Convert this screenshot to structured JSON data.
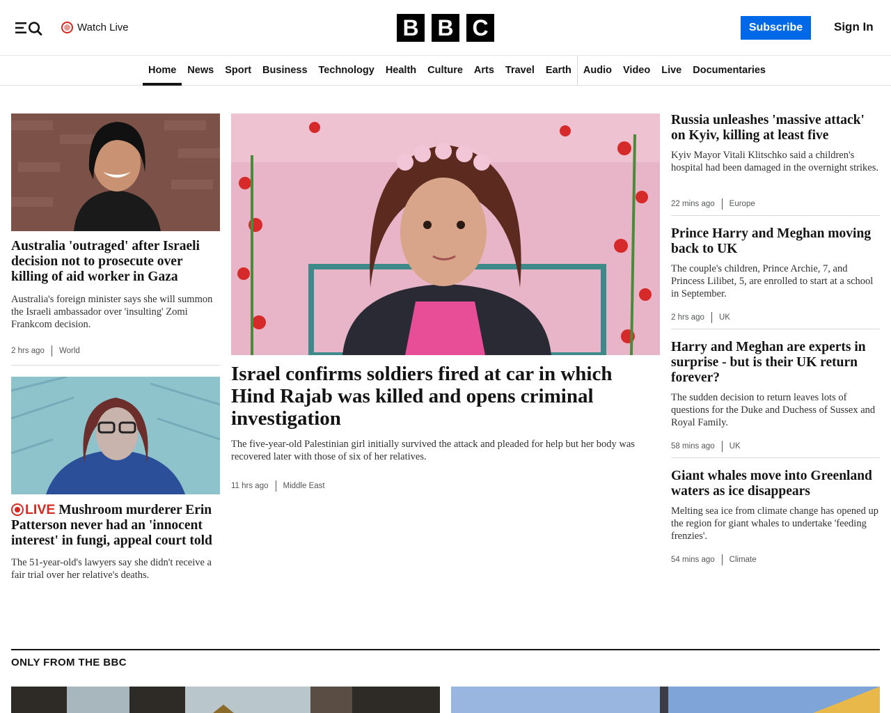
{
  "header": {
    "watch_live": "Watch Live",
    "logo_letters": [
      "B",
      "B",
      "C"
    ],
    "subscribe": "Subscribe",
    "sign_in": "Sign In"
  },
  "nav": {
    "items": [
      "Home",
      "News",
      "Sport",
      "Business",
      "Technology",
      "Health",
      "Culture",
      "Arts",
      "Travel",
      "Earth",
      "Audio",
      "Video",
      "Live",
      "Documentaries"
    ],
    "active": "Home"
  },
  "stories": {
    "left1": {
      "headline": "Australia 'outraged' after Israeli decision not to prosecute over killing of aid worker in Gaza",
      "summary": "Australia's foreign minister says she will summon the Israeli ambassador over 'insulting' Zomi Frankcom decision.",
      "time": "2 hrs ago",
      "section": "World"
    },
    "left2": {
      "live": "LIVE",
      "headline": "Mushroom murderer Erin Patterson never had an 'innocent interest' in fungi, appeal court told",
      "summary": "The 51-year-old's lawyers say she didn't receive a fair trial over her relative's deaths."
    },
    "main": {
      "headline": "Israel confirms soldiers fired at car in which Hind Rajab was killed and opens criminal investigation",
      "summary": "The five-year-old Palestinian girl initially survived the attack and pleaded for help but her body was recovered later with those of six of her relatives.",
      "time": "11 hrs ago",
      "section": "Middle East"
    },
    "right": [
      {
        "headline": "Russia unleashes 'massive attack' on Kyiv, killing at least five",
        "summary": "Kyiv Mayor Vitali Klitschko said a children's hospital had been damaged in the overnight strikes.",
        "time": "22 mins ago",
        "section": "Europe"
      },
      {
        "headline": "Prince Harry and Meghan moving back to UK",
        "summary": "The couple's children, Prince Archie, 7, and Princess Lilibet, 5, are enrolled to start at a school in September.",
        "time": "2 hrs ago",
        "section": "UK"
      },
      {
        "headline": "Harry and Meghan are experts in surprise - but is their UK return forever?",
        "summary": "The sudden decision to return leaves lots of questions for the Duke and Duchess of Sussex and Royal Family.",
        "time": "58 mins ago",
        "section": "UK"
      },
      {
        "headline": "Giant whales move into Greenland waters as ice disappears",
        "summary": "Melting sea ice from climate change has opened up the region for giant whales to undertake 'feeding frenzies'.",
        "time": "54 mins ago",
        "section": "Climate"
      }
    ]
  },
  "section": {
    "title": "ONLY FROM THE BBC"
  },
  "colors": {
    "accent": "#0168e8",
    "live_red": "#d42a20",
    "text": "#141414",
    "meta": "#545658"
  }
}
